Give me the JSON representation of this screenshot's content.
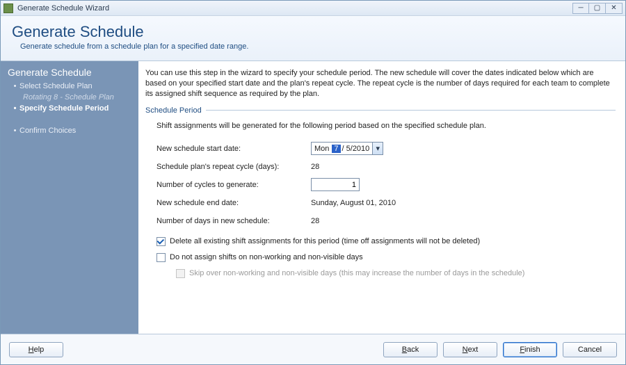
{
  "titlebar": {
    "text": "Generate Schedule Wizard"
  },
  "header": {
    "title": "Generate Schedule",
    "subtitle": "Generate schedule from a schedule plan for a specified date range."
  },
  "sidebar": {
    "title": "Generate Schedule",
    "steps": [
      {
        "label": "Select Schedule Plan",
        "active": false
      },
      {
        "label": "Specify Schedule Period",
        "active": true
      },
      {
        "label": "Confirm Choices",
        "active": false
      }
    ],
    "substep": "Rotating 8 - Schedule Plan"
  },
  "content": {
    "intro": "You can use this step in the wizard to specify your schedule period.  The new schedule will cover the dates indicated below which are based on your specified start date and the plan's repeat cycle. The repeat cycle is the number of days required for each team to complete its assigned shift sequence as required by the plan.",
    "section_label": "Schedule Period",
    "lead": "Shift assignments will be generated for the following period based on the specified schedule plan.",
    "rows": {
      "start_date_label": "New schedule start date:",
      "start_date": {
        "dow": "Mon",
        "sel": "7",
        "rest": "/  5/2010"
      },
      "repeat_label": "Schedule plan's repeat cycle (days):",
      "repeat_value": "28",
      "cycles_label": "Number of cycles to generate:",
      "cycles_value": "1",
      "end_label": "New schedule end date:",
      "end_value": "Sunday, August 01, 2010",
      "days_label": "Number of days in new schedule:",
      "days_value": "28"
    },
    "checks": {
      "delete_label": "Delete all existing shift assignments for this period (time off assignments will not be deleted)",
      "nonworking_label": "Do not assign shifts on non-working and non-visible days",
      "skip_label": "Skip over non-working and non-visible days (this may increase the number of days in the schedule)"
    }
  },
  "footer": {
    "help": "Help",
    "back": "Back",
    "next": "Next",
    "finish": "Finish",
    "cancel": "Cancel"
  }
}
